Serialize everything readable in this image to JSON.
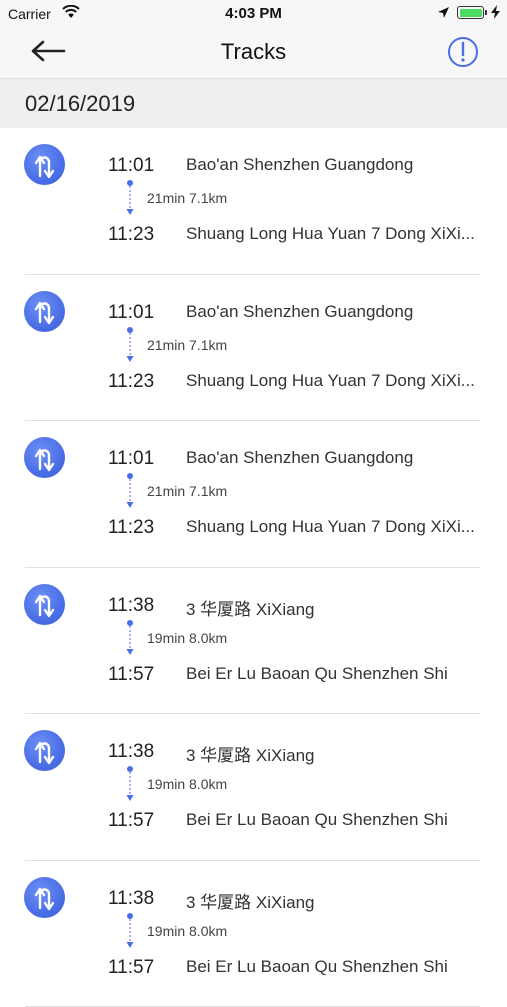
{
  "status_bar": {
    "carrier": "Carrier",
    "time": "4:03 PM"
  },
  "nav": {
    "title": "Tracks",
    "back_icon": "arrow-left-icon",
    "info_icon": "info-circle-icon"
  },
  "date": "02/16/2019",
  "colors": {
    "accent": "#4a6ee6",
    "separator": "#e2e2e2",
    "header_bg": "#efefef"
  },
  "tracks": [
    {
      "start_time": "11:01",
      "start_place": "Bao'an Shenzhen Guangdong",
      "summary": "21min 7.1km",
      "end_time": "11:23",
      "end_place": "Shuang Long Hua Yuan 7 Dong XiXi..."
    },
    {
      "start_time": "11:01",
      "start_place": "Bao'an Shenzhen Guangdong",
      "summary": "21min 7.1km",
      "end_time": "11:23",
      "end_place": "Shuang Long Hua Yuan 7 Dong XiXi..."
    },
    {
      "start_time": "11:01",
      "start_place": "Bao'an Shenzhen Guangdong",
      "summary": "21min 7.1km",
      "end_time": "11:23",
      "end_place": "Shuang Long Hua Yuan 7 Dong XiXi..."
    },
    {
      "start_time": "11:38",
      "start_place": "3 华厦路 XiXiang",
      "summary": "19min 8.0km",
      "end_time": "11:57",
      "end_place": "Bei Er Lu Baoan Qu Shenzhen Shi"
    },
    {
      "start_time": "11:38",
      "start_place": "3 华厦路 XiXiang",
      "summary": "19min 8.0km",
      "end_time": "11:57",
      "end_place": "Bei Er Lu Baoan Qu Shenzhen Shi"
    },
    {
      "start_time": "11:38",
      "start_place": "3 华厦路 XiXiang",
      "summary": "19min 8.0km",
      "end_time": "11:57",
      "end_place": "Bei Er Lu Baoan Qu Shenzhen Shi"
    }
  ]
}
